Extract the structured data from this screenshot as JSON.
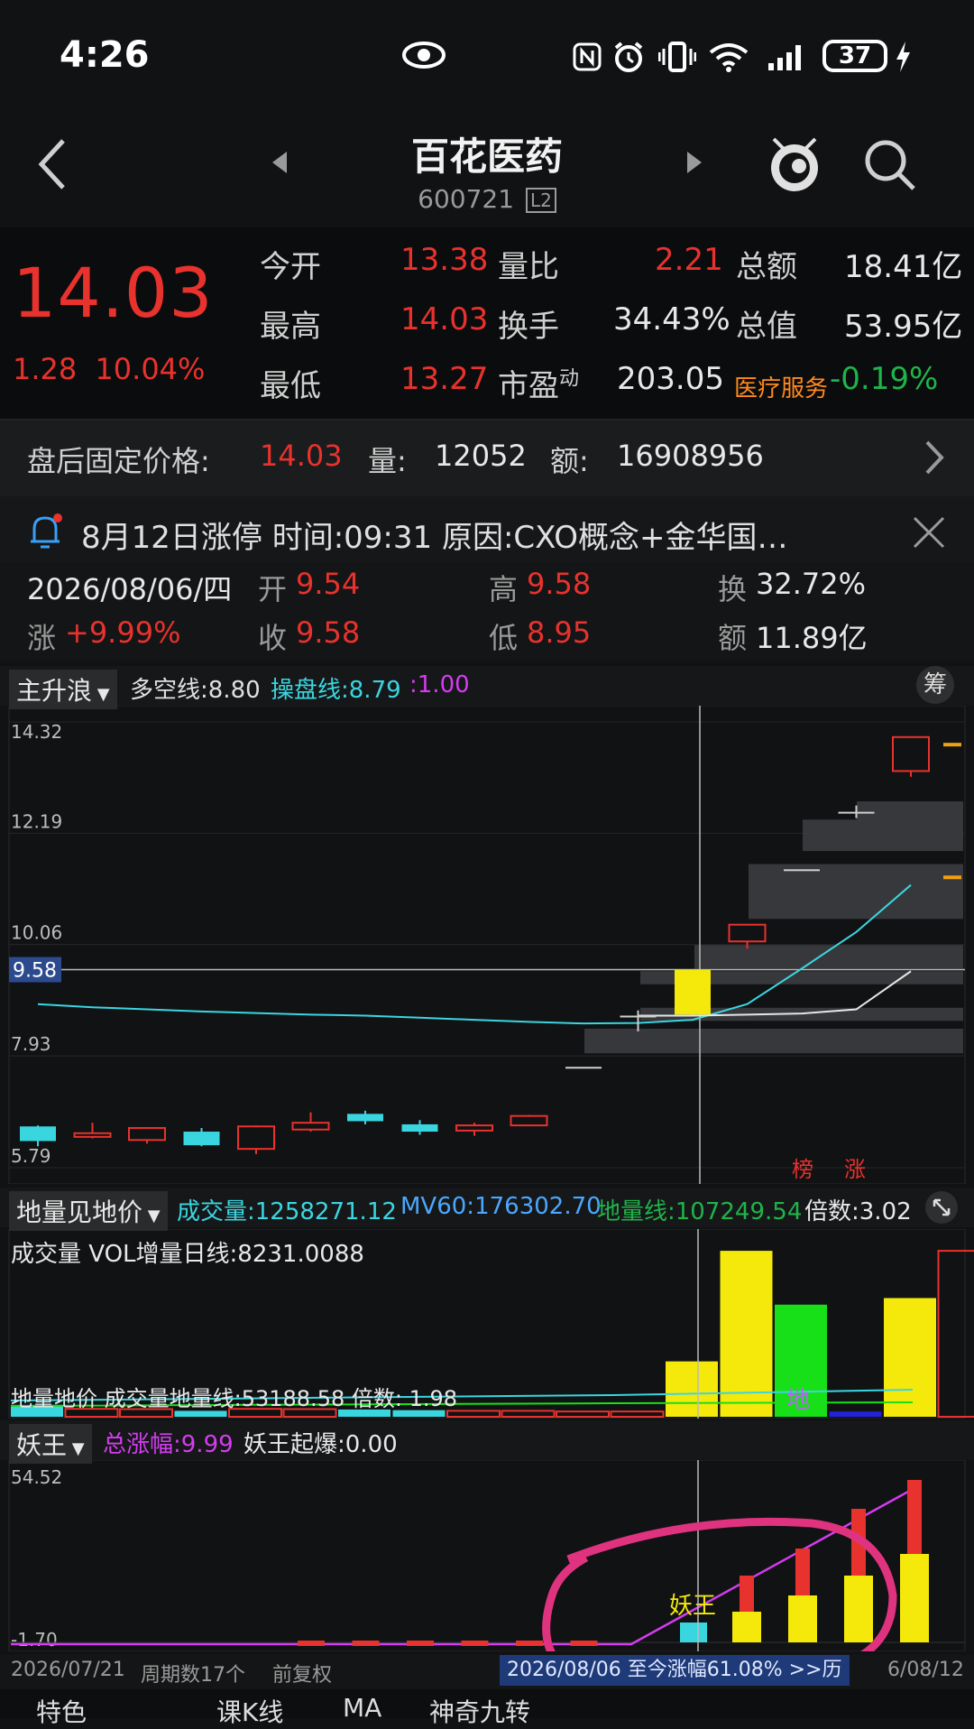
{
  "status_bar": {
    "time": "4:26",
    "battery": "37"
  },
  "header": {
    "title": "百花医药",
    "code": "600721",
    "level_badge": "L2"
  },
  "quote": {
    "price": "14.03",
    "change": "1.28",
    "change_pct": "10.04%",
    "open_label": "今开",
    "open": "13.38",
    "high_label": "最高",
    "high": "14.03",
    "low_label": "最低",
    "low": "13.27",
    "volratio_label": "量比",
    "volratio": "2.21",
    "turnover_label": "换手",
    "turnover": "34.43%",
    "pe_label": "市盈",
    "pe_sup": "动",
    "pe": "203.05",
    "amount_label": "总额",
    "amount": "18.41亿",
    "mcap_label": "总值",
    "mcap": "53.95亿",
    "sector": "医疗服务",
    "sector_change": "-0.19%"
  },
  "after_hours": {
    "label": "盘后固定价格:",
    "price": "14.03",
    "vol_label": "量:",
    "vol": "12052",
    "amt_label": "额:",
    "amt": "16908956"
  },
  "alert": {
    "text": "8月12日涨停  时间:09:31  原因:CXO概念+金华国…"
  },
  "kline_info": {
    "date": "2026/08/06/四",
    "open_label": "开",
    "open": "9.54",
    "high_label": "高",
    "high": "9.58",
    "turnover_label": "换",
    "turnover": "32.72%",
    "chg_label": "涨",
    "chg": "+9.99%",
    "close_label": "收",
    "close": "9.58",
    "low_label": "低",
    "low": "8.95",
    "amount_label": "额",
    "amount": "11.89亿"
  },
  "main_indicator": {
    "name": "主升浪",
    "dk_label": "多空线:",
    "dk": "8.80",
    "cp_label": "操盘线:",
    "cp": "8.79",
    "ratio": ":1.00",
    "chip_button": "筹"
  },
  "vol_indicator": {
    "name": "地量见地价",
    "vol_label": "成交量:",
    "vol": "1258271.12",
    "mv60_label": "MV60:",
    "mv60": "176302.70",
    "dl_label": "地量线:",
    "dl": "107249.54",
    "mult_label": "倍数:",
    "mult": "3.02",
    "overlay_row1": "成交量 VOL增量日线:8231.0088",
    "overlay_row2": "地量地价 成交量地量线:53188.58 倍数: 1.98",
    "di_mark": "地"
  },
  "yao_indicator": {
    "name": "妖王",
    "total_label": "总涨幅:",
    "total": "9.99",
    "burst_label": "妖王起爆:",
    "burst": "0.00",
    "mark": "妖王"
  },
  "chart_labels": {
    "bang": "榜",
    "zhang": "涨"
  },
  "footer": {
    "start_date": "2026/07/21",
    "period": "周期数17个",
    "adjust": "前复权",
    "range_text": "2026/08/06 至今涨幅61.08%  >>历",
    "end_date": "6/08/12"
  },
  "bottom_nav": {
    "items": [
      "特色",
      "课K线",
      "MA",
      "神奇九转"
    ]
  },
  "chart_data": [
    {
      "type": "candlestick",
      "title": "",
      "ylim": [
        5.79,
        14.32
      ],
      "y_ticks": [
        "14.32",
        "12.19",
        "10.06",
        "7.93",
        "5.79"
      ],
      "crosshair_value": "9.58",
      "candles": [
        {
          "o": 6.3,
          "c": 6.58,
          "h": 6.6,
          "l": 6.2,
          "dir": "down"
        },
        {
          "o": 6.38,
          "c": 6.45,
          "h": 6.65,
          "l": 6.35,
          "dir": "up"
        },
        {
          "o": 6.32,
          "c": 6.55,
          "h": 6.55,
          "l": 6.25,
          "dir": "up"
        },
        {
          "o": 6.22,
          "c": 6.48,
          "h": 6.55,
          "l": 6.2,
          "dir": "down"
        },
        {
          "o": 6.15,
          "c": 6.58,
          "h": 6.6,
          "l": 6.05,
          "dir": "up"
        },
        {
          "o": 6.52,
          "c": 6.65,
          "h": 6.85,
          "l": 6.48,
          "dir": "up"
        },
        {
          "o": 6.68,
          "c": 6.82,
          "h": 6.88,
          "l": 6.62,
          "dir": "down"
        },
        {
          "o": 6.48,
          "c": 6.62,
          "h": 6.7,
          "l": 6.42,
          "dir": "down"
        },
        {
          "o": 6.5,
          "c": 6.6,
          "h": 6.65,
          "l": 6.4,
          "dir": "up"
        },
        {
          "o": 6.6,
          "c": 6.78,
          "h": 6.8,
          "l": 6.6,
          "dir": "up"
        },
        {
          "o": 7.72,
          "c": 7.72,
          "h": 7.72,
          "l": 7.72,
          "dir": "flat"
        },
        {
          "o": 8.7,
          "c": 8.7,
          "h": 8.8,
          "l": 8.4,
          "dir": "flat"
        },
        {
          "o": 8.72,
          "c": 9.58,
          "h": 9.58,
          "l": 8.72,
          "dir": "limit"
        },
        {
          "o": 10.12,
          "c": 10.44,
          "h": 10.44,
          "l": 9.98,
          "dir": "up"
        },
        {
          "o": 11.5,
          "c": 11.5,
          "h": 11.5,
          "l": 11.5,
          "dir": "flat"
        },
        {
          "o": 12.6,
          "c": 12.6,
          "h": 12.72,
          "l": 12.48,
          "dir": "flat"
        },
        {
          "o": 13.38,
          "c": 14.03,
          "h": 14.03,
          "l": 13.27,
          "dir": "up"
        }
      ],
      "series": [
        {
          "name": "多空线",
          "color": "#3ad6e0",
          "values": [
            8.92,
            8.86,
            8.82,
            8.78,
            8.75,
            8.72,
            8.7,
            8.66,
            8.62,
            8.58,
            8.55,
            8.56,
            8.62,
            8.92,
            9.6,
            10.3,
            11.2
          ]
        },
        {
          "name": "操盘线",
          "color": "#e6e6e6",
          "values": [
            null,
            null,
            null,
            null,
            null,
            null,
            null,
            null,
            null,
            null,
            null,
            8.7,
            8.7,
            8.72,
            8.74,
            8.82,
            9.55
          ]
        }
      ]
    },
    {
      "type": "bar",
      "title": "",
      "ylim": [
        0,
        1300000
      ],
      "values": [
        90000,
        60000,
        58000,
        45000,
        60000,
        58000,
        55000,
        50000,
        45000,
        45000,
        40000,
        40000,
        420000,
        1258271,
        850000,
        40000,
        900000,
        1258271
      ],
      "colors": [
        "cyan",
        "red",
        "red",
        "cyan",
        "red",
        "red",
        "cyan",
        "cyan",
        "red",
        "red",
        "red",
        "red",
        "yellow",
        "yellow",
        "green",
        "blue",
        "yellow",
        "red-hollow"
      ]
    },
    {
      "type": "bar",
      "title": "",
      "ylim": [
        -1.7,
        54.52
      ],
      "y_ticks": [
        "54.52",
        "-1.70"
      ]
    }
  ]
}
